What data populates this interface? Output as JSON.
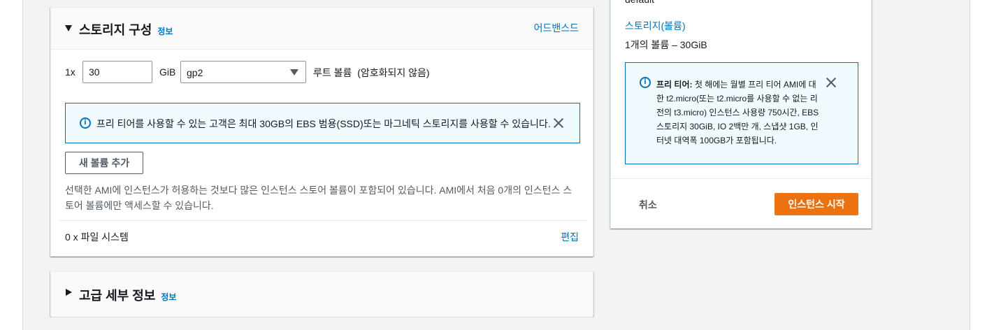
{
  "storage_section": {
    "title": "스토리지 구성",
    "info_link": "정보",
    "advanced_link": "어드밴스드",
    "volume": {
      "count": "1x",
      "size_value": "30",
      "size_unit": "GiB",
      "type_selected": "gp2",
      "root_label": "루트 볼륨  (암호화되지 않음)"
    },
    "alert": {
      "text": "프리 티어를 사용할 수 있는 고객은 최대 30GB의 EBS 범용(SSD)또는 마그네틱 스토리지를 사용할 수 있습니다."
    },
    "add_volume_label": "새 볼륨 추가",
    "instance_store_note": "선택한 AMI에 인스턴스가 허용하는 것보다 많은 인스턴스 스토어 볼륨이 포함되어 있습니다. AMI에서 처음 0개의 인스턴스 스토어 볼륨에만 액세스할 수 있습니다.",
    "file_systems_label": "0 x 파일 시스템",
    "edit_link": "편집"
  },
  "advanced_section": {
    "title": "고급 세부 정보",
    "info_link": "정보"
  },
  "summary": {
    "top_text": "default",
    "storage_heading": "스토리지(볼륨)",
    "storage_value": "1개의 볼륨 – 30GiB",
    "free_tier_alert": {
      "bold_label": "프리 티어:",
      "text": " 첫 해에는 월별 프리 티어 AMI에 대한 t2.micro(또는 t2.micro를 사용할 수 없는 리전의 t3.micro) 인스턴스 사용량 750시간, EBS 스토리지 30GiB, IO 2백만 개, 스냅샷 1GB, 인터넷 대역폭 100GB가 포함됩니다."
    },
    "cancel_label": "취소",
    "launch_label": "인스턴스 시작"
  },
  "icons": {
    "info": "info-icon",
    "close": "close-icon",
    "expand": "caret-down-icon",
    "collapse": "caret-right-icon",
    "dropdown": "select-arrow-icon"
  },
  "colors": {
    "link": "#0073bb",
    "primary_button": "#ec7211",
    "alert_border": "#0073bb",
    "alert_bg": "#f1faff"
  }
}
